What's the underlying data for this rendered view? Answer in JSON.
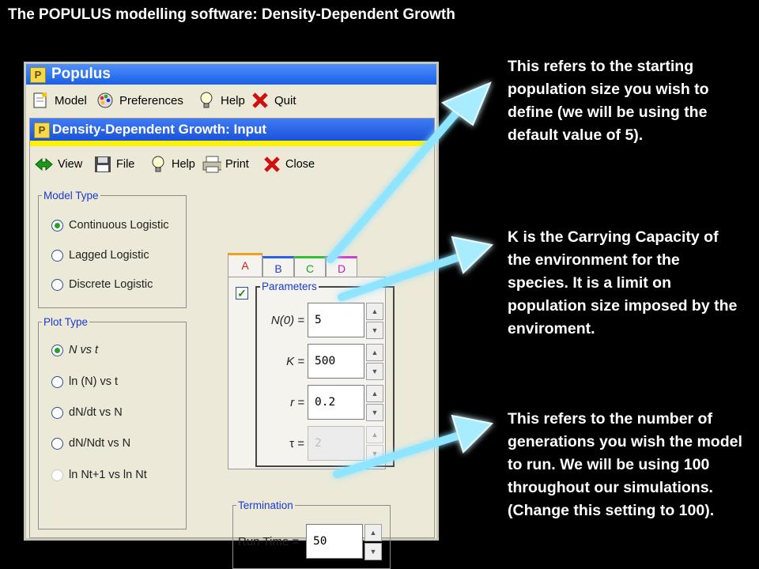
{
  "slide_title": "The POPULUS modelling software: Density-Dependent Growth",
  "app": {
    "title": "Populus",
    "menu": [
      {
        "label": "Model",
        "icon": "document-icon"
      },
      {
        "label": "Preferences",
        "icon": "palette-icon"
      },
      {
        "label": "Help",
        "icon": "lightbulb-icon"
      },
      {
        "label": "Quit",
        "icon": "close-icon"
      }
    ]
  },
  "inner": {
    "title": "Density-Dependent Growth: Input",
    "toolbar": [
      {
        "label": "View",
        "icon": "double-arrow-icon"
      },
      {
        "label": "File",
        "icon": "floppy-icon"
      },
      {
        "label": "Help",
        "icon": "lightbulb-icon"
      },
      {
        "label": "Print",
        "icon": "printer-icon"
      },
      {
        "label": "Close",
        "icon": "close-icon"
      }
    ],
    "model_type": {
      "legend": "Model Type",
      "options": [
        "Continuous Logistic",
        "Lagged Logistic",
        "Discrete Logistic"
      ],
      "selected": "Continuous Logistic"
    },
    "plot_type": {
      "legend": "Plot Type",
      "options": [
        "N vs t",
        "ln (N) vs t",
        "dN/dt vs N",
        "dN/Ndt vs N",
        "ln Nt+1 vs ln Nt"
      ],
      "selected": "N vs t"
    },
    "tabs": [
      "A",
      "B",
      "C",
      "D"
    ],
    "active_tab": "A",
    "parameters": {
      "legend": "Parameters",
      "checked": true,
      "rows": [
        {
          "label": "N(0) =",
          "value": "5",
          "enabled": true
        },
        {
          "label": "K =",
          "value": "500",
          "enabled": true
        },
        {
          "label": "r =",
          "value": "0.2",
          "enabled": true
        },
        {
          "label": "τ =",
          "value": "2",
          "enabled": false
        }
      ]
    },
    "termination": {
      "legend": "Termination",
      "label": "Run Time =",
      "value": "50"
    }
  },
  "notes": [
    "This refers to the starting population size you wish to define  (we will be using the default value of 5).",
    "K is the Carrying Capacity of the environment for the species.  It is a limit on population size imposed by the enviroment.",
    "This refers to the number of generations you wish the model to run.  We will be using 100 throughout our simulations.  (Change this setting to 100)."
  ]
}
